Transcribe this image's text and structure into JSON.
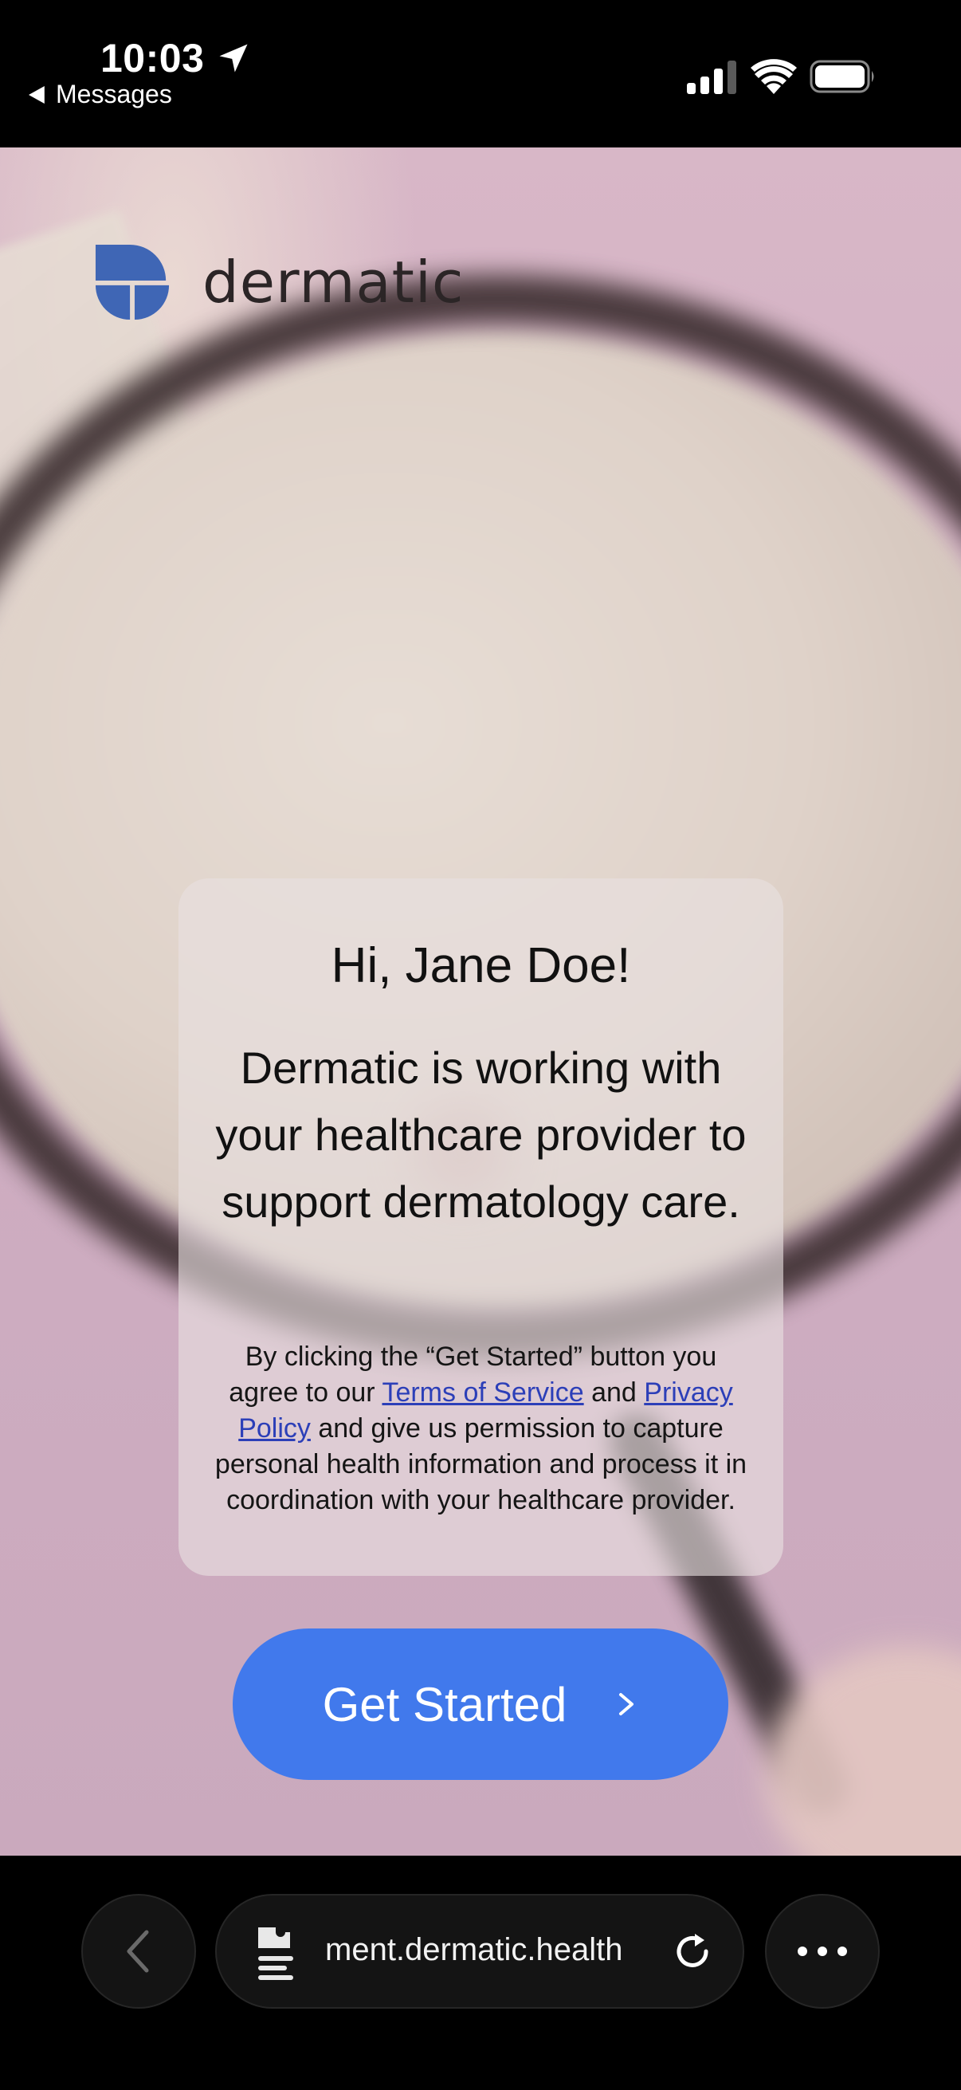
{
  "status_bar": {
    "time": "10:03",
    "back_label": "Messages"
  },
  "brand": {
    "name": "dermatic",
    "logo_color": "#3f66b5"
  },
  "card": {
    "greeting": "Hi, Jane Doe!",
    "body": "Dermatic is working with your healthcare provider to support dermatology care.",
    "legal_prefix": "By clicking the “Get Started” button you agree to our ",
    "terms_link": "Terms of Service",
    "legal_and": " and ",
    "privacy_link": "Privacy Policy",
    "legal_suffix": " and give us permission to capture personal health information and process it in coordination with your healthcare provider."
  },
  "cta": {
    "label": "Get Started",
    "color": "#4179ec"
  },
  "browser": {
    "url": "ment.dermatic.health"
  }
}
